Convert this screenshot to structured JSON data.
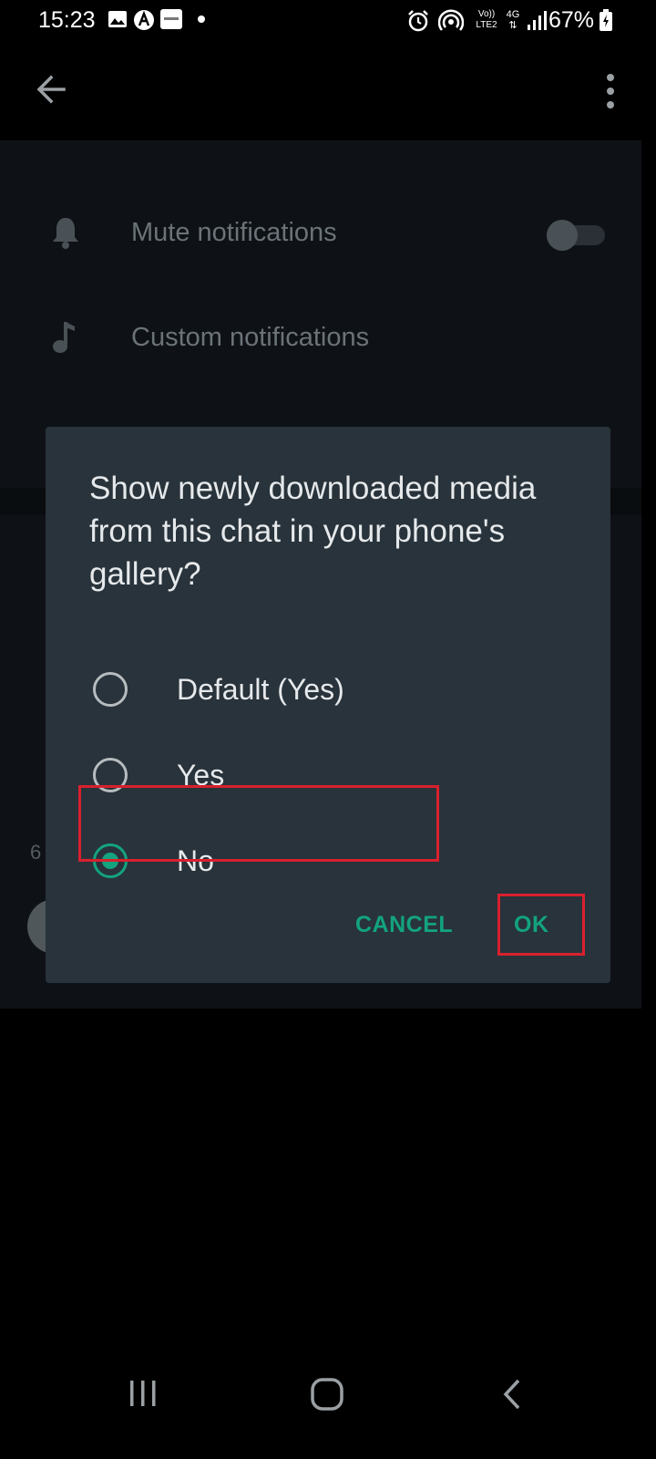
{
  "status_bar": {
    "time": "15:23",
    "battery": "67%",
    "network": "4G",
    "lte": "LTE2",
    "volte": "Vo))"
  },
  "settings": [
    {
      "label": "Mute notifications",
      "icon": "bell-icon",
      "has_toggle": true,
      "toggle_on": false
    },
    {
      "label": "Custom notifications",
      "icon": "music-note-icon",
      "has_toggle": false
    }
  ],
  "background_fragment": "6",
  "dialog": {
    "title": "Show newly downloaded media from this chat in your phone's gallery?",
    "options": [
      {
        "label": "Default (Yes)",
        "checked": false
      },
      {
        "label": "Yes",
        "checked": false
      },
      {
        "label": "No",
        "checked": true
      }
    ],
    "cancel_label": "CANCEL",
    "ok_label": "OK"
  },
  "colors": {
    "accent": "#14a47e",
    "dialog_bg": "#28333b",
    "highlight": "#d9202e"
  }
}
